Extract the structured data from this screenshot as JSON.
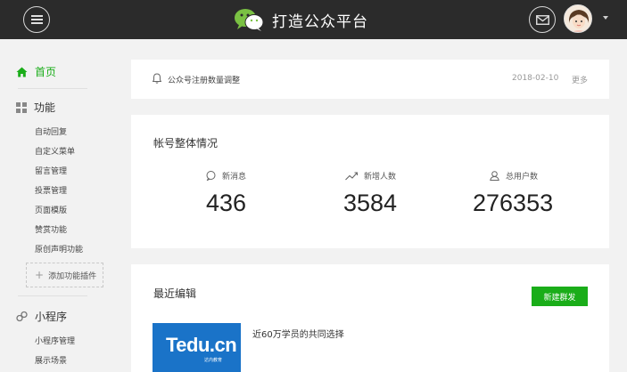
{
  "header": {
    "title": "打造公众平台",
    "icons": {
      "menu": "menu-icon",
      "logo": "wechat-logo-icon",
      "mail": "mail-icon",
      "caret": "chevron-down-icon"
    },
    "colors": {
      "bar": "#2b2b2b",
      "brand": "#7ac143"
    }
  },
  "sidebar": {
    "home": {
      "label": "首页",
      "icon": "home-icon"
    },
    "functions": {
      "label": "功能",
      "icon": "grid-icon",
      "items": [
        {
          "label": "自动回复"
        },
        {
          "label": "自定义菜单"
        },
        {
          "label": "留言管理"
        },
        {
          "label": "投票管理"
        },
        {
          "label": "页面模版"
        },
        {
          "label": "赞赏功能"
        },
        {
          "label": "原创声明功能"
        }
      ],
      "add_plugin": "添加功能插件"
    },
    "mini_program": {
      "label": "小程序",
      "icon": "link-icon",
      "items": [
        {
          "label": "小程序管理"
        },
        {
          "label": "展示场景"
        }
      ]
    },
    "active_color": "#1aad19"
  },
  "notice": {
    "icon": "bell-icon",
    "text": "公众号注册数量调整",
    "date": "2018-02-10",
    "more": "更多"
  },
  "account_stats": {
    "title": "帐号整体情况",
    "items": [
      {
        "label": "新消息",
        "value": "436",
        "icon": "message-icon"
      },
      {
        "label": "新增人数",
        "value": "3584",
        "icon": "trend-icon"
      },
      {
        "label": "总用户数",
        "value": "276353",
        "icon": "user-icon"
      }
    ]
  },
  "recent": {
    "title": "最近编辑",
    "new_button": "新建群发",
    "article": {
      "thumb_brand": "Tedu.cn",
      "thumb_sub": "达内教育",
      "title": "近60万学员的共同选择"
    }
  }
}
